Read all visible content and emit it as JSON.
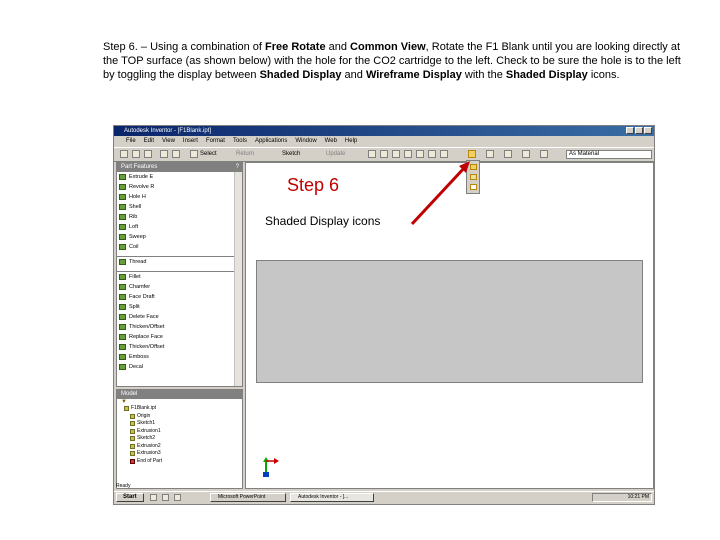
{
  "instructions": {
    "p1": "Step 6. – Using a combination of ",
    "b1": "Free Rotate",
    "p2": "  and ",
    "b2": "Common View",
    "p3": ", Rotate the F1 Blank until you are looking directly at the TOP surface (as shown below) with the hole for the CO2 cartridge to the left. Check to be sure the hole is to the left by toggling the display between ",
    "b3": "Shaded Display",
    "p4": " and ",
    "b4": "Wireframe Display",
    "p5": " with the ",
    "b5": "Shaded Display",
    "p6": " icons."
  },
  "window": {
    "title": "Autodesk Inventor - [F1Blank.ipt]",
    "menu": [
      "File",
      "Edit",
      "View",
      "Insert",
      "Format",
      "Tools",
      "Applications",
      "Window",
      "Web",
      "Help"
    ],
    "toolbar": {
      "select_label": "Select",
      "return_label": "Return",
      "sketch_label": "Sketch",
      "update_label": "Update",
      "material": "As Material"
    }
  },
  "browser": {
    "header": "Part Features",
    "features": [
      {
        "label": "Extrude",
        "key": "E"
      },
      {
        "label": "Revolve",
        "key": "R"
      },
      {
        "label": "Hole",
        "key": "H"
      },
      {
        "label": "Shell",
        "key": ""
      },
      {
        "label": "Rib",
        "key": ""
      },
      {
        "label": "Loft",
        "key": ""
      },
      {
        "label": "Sweep",
        "key": ""
      },
      {
        "label": "Coil",
        "key": ""
      }
    ],
    "thread_label": "Thread",
    "features2": [
      {
        "label": "Fillet"
      },
      {
        "label": "Chamfer"
      },
      {
        "label": "Face Draft"
      },
      {
        "label": "Split"
      },
      {
        "label": "Delete Face"
      },
      {
        "label": "Thicken/Offset"
      },
      {
        "label": "Replace Face"
      },
      {
        "label": "Thicken/Offset"
      },
      {
        "label": "Emboss"
      },
      {
        "label": "Decal"
      }
    ]
  },
  "model": {
    "header": "Model",
    "items": [
      "F1Blank.ipt",
      "Origin",
      "Sketch1",
      "Extrusion1",
      "Sketch2",
      "Extrusion2",
      "Extrusion3",
      "End of Part"
    ]
  },
  "status": "Ready",
  "taskbar": {
    "start": "Start",
    "tasks": [
      "Microsoft PowerPoint",
      "Autodesk Inventor - [..."
    ],
    "clock": "10:21 PM"
  },
  "annotation": {
    "step": "Step 6",
    "label": "Shaded Display icons",
    "color": "#c00000"
  }
}
